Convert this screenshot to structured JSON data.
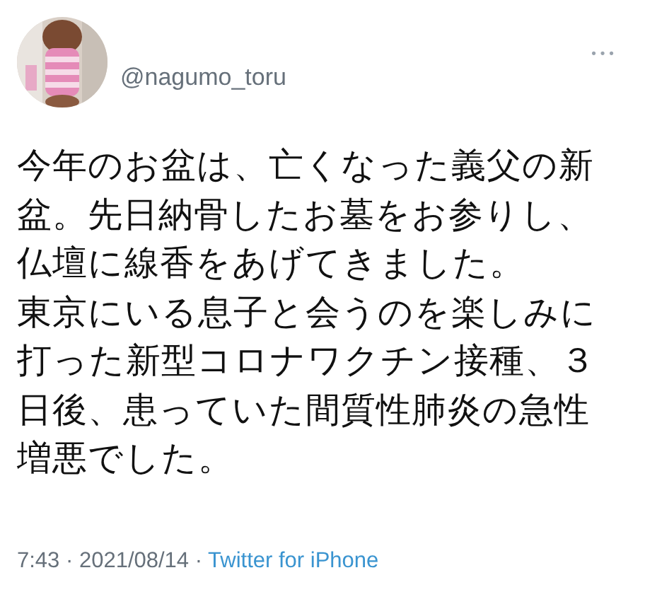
{
  "tweet": {
    "handle": "@nagumo_toru",
    "more": "•••",
    "text_lines": [
      "今年のお盆は、亡くなった義父の新",
      "盆。先日納骨したお墓をお参りし、",
      "仏壇に線香をあげてきました。",
      "東京にいる息子と会うのを楽しみに",
      "打った新型コロナワクチン接種、３",
      "日後、患っていた間質性肺炎の急性",
      "増悪でした。"
    ],
    "time": "7:43",
    "separator": "·",
    "date": "2021/08/14",
    "source": "Twitter for iPhone"
  }
}
